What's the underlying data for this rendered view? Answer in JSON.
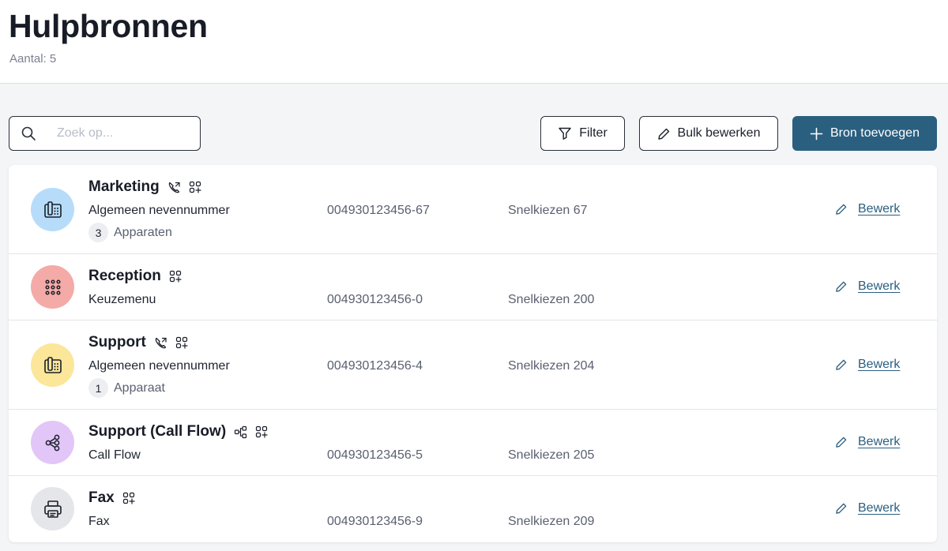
{
  "header": {
    "title": "Hulpbronnen",
    "count_text": "Aantal: 5"
  },
  "toolbar": {
    "search_placeholder": "Zoek op...",
    "filter_label": "Filter",
    "bulk_label": "Bulk bewerken",
    "add_label": "Bron toevoegen"
  },
  "colors": {
    "primary": "#2b5f80",
    "avatar_blue": "#b6dcfa",
    "avatar_red": "#f4aaa6",
    "avatar_yellow": "#fbe69a",
    "avatar_purple": "#e2c6f8",
    "avatar_gray": "#e5e6e9"
  },
  "resources": [
    {
      "name": "Marketing",
      "type": "Algemeen nevennummer",
      "number": "004930123456-67",
      "speed_dial": "Snelkiezen 67",
      "device_count": "3",
      "device_label": "Apparaten",
      "edit_label": "Bewerk",
      "icon": "desk-phone-icon",
      "badges": [
        "call-forward-icon",
        "apps-add-icon"
      ]
    },
    {
      "name": "Reception",
      "type": "Keuzemenu",
      "number": "004930123456-0",
      "speed_dial": "Snelkiezen 200",
      "edit_label": "Bewerk",
      "icon": "keypad-icon",
      "badges": [
        "apps-add-icon"
      ]
    },
    {
      "name": "Support",
      "type": "Algemeen nevennummer",
      "number": "004930123456-4",
      "speed_dial": "Snelkiezen 204",
      "device_count": "1",
      "device_label": "Apparaat",
      "edit_label": "Bewerk",
      "icon": "desk-phone-icon",
      "badges": [
        "call-forward-icon",
        "apps-add-icon"
      ]
    },
    {
      "name": "Support (Call Flow)",
      "type": "Call Flow",
      "number": "004930123456-5",
      "speed_dial": "Snelkiezen 205",
      "edit_label": "Bewerk",
      "icon": "call-flow-icon",
      "badges": [
        "flow-chart-icon",
        "apps-add-icon"
      ]
    },
    {
      "name": "Fax",
      "type": "Fax",
      "number": "004930123456-9",
      "speed_dial": "Snelkiezen 209",
      "edit_label": "Bewerk",
      "icon": "printer-icon",
      "badges": [
        "apps-add-icon"
      ]
    }
  ]
}
